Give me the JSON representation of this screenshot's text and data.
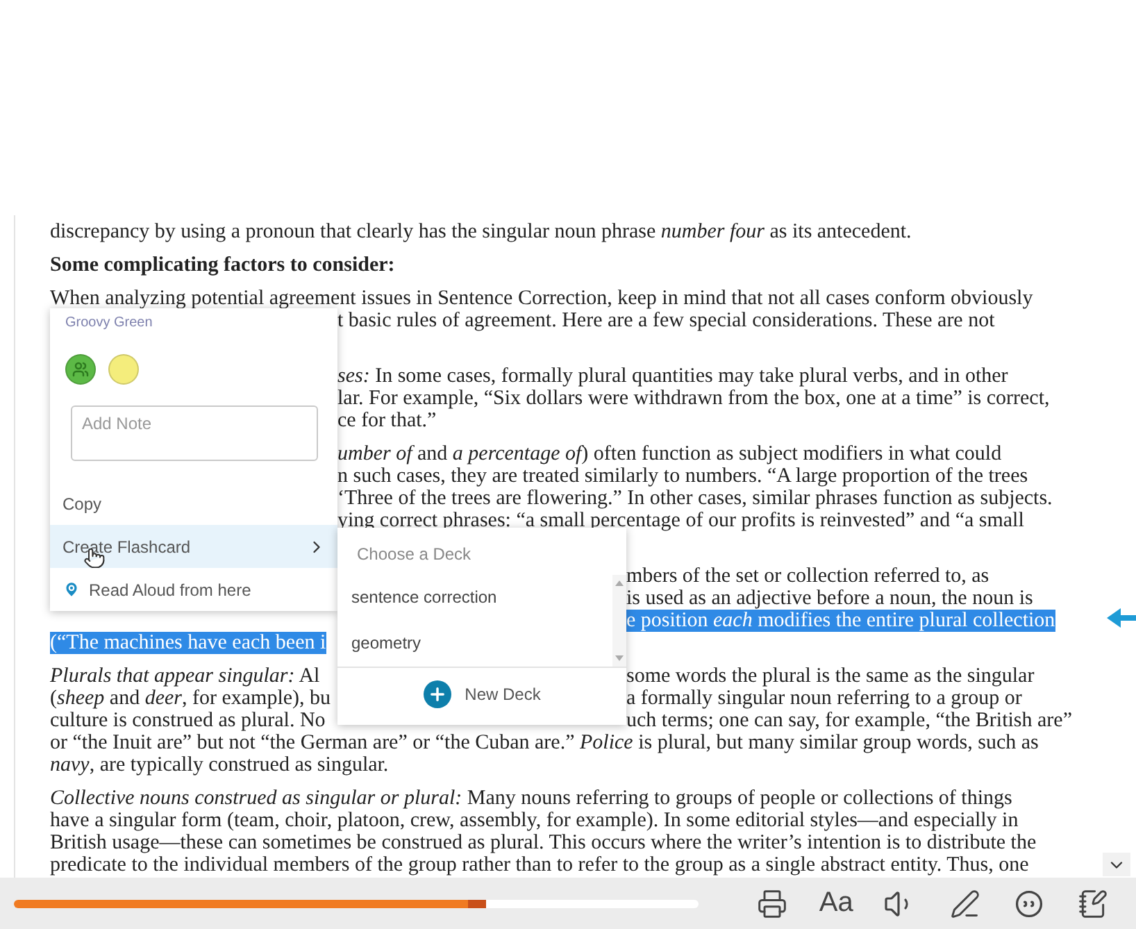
{
  "document": {
    "paragraphs": [
      {
        "kind": "body",
        "lines": [
          {
            "kind": "full",
            "segments": [
              {
                "text": "discrepancy by using a pronoun that clearly has the singular noun phrase *number four* as its antecedent.",
                "selected": false
              }
            ]
          }
        ]
      },
      {
        "kind": "heading",
        "lines": [
          {
            "kind": "full",
            "segments": [
              {
                "text": "Some complicating factors to consider:",
                "selected": false
              }
            ]
          }
        ]
      },
      {
        "kind": "body",
        "lines": [
          {
            "kind": "full",
            "segments": [
              {
                "text": "When analyzing potential agreement issues in Sentence Correction, keep in mind that not all cases conform obviously",
                "selected": false
              }
            ]
          },
          {
            "kind": "cut_left",
            "segments": [
              {
                "text": "t basic rules of agreement. Here are a few special considerations. These are not",
                "selected": false
              }
            ]
          },
          {
            "kind": "covered"
          }
        ]
      },
      {
        "kind": "body",
        "lines": [
          {
            "kind": "cut_left",
            "segments": [
              {
                "text": "*ses:* In some cases, formally plural quantities may take plural verbs, and in other",
                "selected": false
              }
            ]
          },
          {
            "kind": "cut_left",
            "segments": [
              {
                "text": "lar. For example, “Six dollars were withdrawn from the box, one at a time” is correct,",
                "selected": false
              }
            ]
          },
          {
            "kind": "cut_left",
            "segments": [
              {
                "text": "ce for that.”",
                "selected": false
              }
            ]
          }
        ]
      },
      {
        "kind": "body",
        "lines": [
          {
            "kind": "cut_left",
            "segments": [
              {
                "text": "*umber of* and *a percentage of*) often function as subject modifiers in what could",
                "selected": false
              }
            ]
          },
          {
            "kind": "cut_left",
            "segments": [
              {
                "text": "n such cases, they are treated similarly to numbers. “A large proportion of the trees",
                "selected": false
              }
            ]
          },
          {
            "kind": "cut_left",
            "segments": [
              {
                "text": "‘Three of the trees are flowering.” In other cases, similar phrases function as subjects.",
                "selected": false
              }
            ]
          },
          {
            "kind": "cut_left",
            "segments": [
              {
                "text": "ying correct phrases: “a small percentage of our profits is reinvested” and “a small",
                "selected": false
              }
            ]
          },
          {
            "kind": "covered"
          }
        ]
      },
      {
        "kind": "body",
        "lines": [
          {
            "kind": "right_only",
            "segments": [
              {
                "text": "mbers of the set or collection referred to, as",
                "selected": false
              }
            ]
          },
          {
            "kind": "right_only",
            "segments": [
              {
                "text": "is used as an adjective before a noun, the noun is",
                "selected": false
              }
            ]
          },
          {
            "kind": "right_only",
            "segments": [
              {
                "text": "e position *each* modifies the entire plural collection",
                "selected": true
              }
            ]
          },
          {
            "kind": "left_only",
            "segments": [
              {
                "text": "(“The machines have each been i",
                "selected": true
              }
            ]
          }
        ]
      },
      {
        "kind": "body",
        "lines": [
          {
            "kind": "split",
            "segments": [
              {
                "text": "*Plurals that appear singular:* Al",
                "selected": false
              },
              {
                "text": "some words the plural is the same as the singular",
                "selected": false
              }
            ]
          },
          {
            "kind": "split",
            "segments": [
              {
                "text": "(*sheep* and *deer*, for example), bu",
                "selected": false
              },
              {
                "text": "a formally singular noun referring to a group or",
                "selected": false
              }
            ]
          },
          {
            "kind": "split",
            "segments": [
              {
                "text": "culture is construed as plural. No",
                "selected": false
              },
              {
                "text": "uch terms; one can say, for example, “the British are”",
                "selected": false
              }
            ]
          },
          {
            "kind": "full",
            "segments": [
              {
                "text": "or “the Inuit are” but not “the German are” or “the Cuban are.” *Police* is plural, but many similar group words, such as",
                "selected": false
              }
            ]
          },
          {
            "kind": "full",
            "segments": [
              {
                "text": "*navy*, are typically construed as singular.",
                "selected": false
              }
            ]
          }
        ]
      },
      {
        "kind": "body",
        "lines": [
          {
            "kind": "full",
            "segments": [
              {
                "text": "*Collective nouns construed as singular or plural:* Many nouns referring to groups of people or collections of things",
                "selected": false
              }
            ]
          },
          {
            "kind": "full",
            "segments": [
              {
                "text": "have a singular form (team, choir, platoon, crew, assembly, for example). In some editorial styles—and especially in",
                "selected": false
              }
            ]
          },
          {
            "kind": "full",
            "segments": [
              {
                "text": "British usage—these can sometimes be construed as plural. This occurs where the writer’s intention is to distribute the",
                "selected": false
              }
            ]
          },
          {
            "kind": "full",
            "segments": [
              {
                "text": "predicate to the individual members of the group rather than to refer to the group as a single abstract entity. Thus, one",
                "selected": false
              }
            ]
          }
        ]
      }
    ]
  },
  "highlight_menu": {
    "color_name": "Groovy Green",
    "swatches": [
      {
        "color": "#5cb946",
        "selected": true
      },
      {
        "color": "#f4ed7c",
        "selected": false
      }
    ],
    "note": {
      "placeholder": "Add Note"
    },
    "items": [
      {
        "kind": "action",
        "label": "Copy",
        "selected": false
      },
      {
        "kind": "submenu",
        "label": "Create Flashcard",
        "selected": true
      },
      {
        "kind": "location",
        "label": "Read Aloud from here",
        "selected": false
      }
    ]
  },
  "deck_menu": {
    "title": "Choose a Deck",
    "decks": [
      "sentence correction",
      "geometry"
    ],
    "new_deck": "New Deck"
  },
  "toolbar": {
    "progress": {
      "level": 0.69
    },
    "text_size": "Aa"
  }
}
